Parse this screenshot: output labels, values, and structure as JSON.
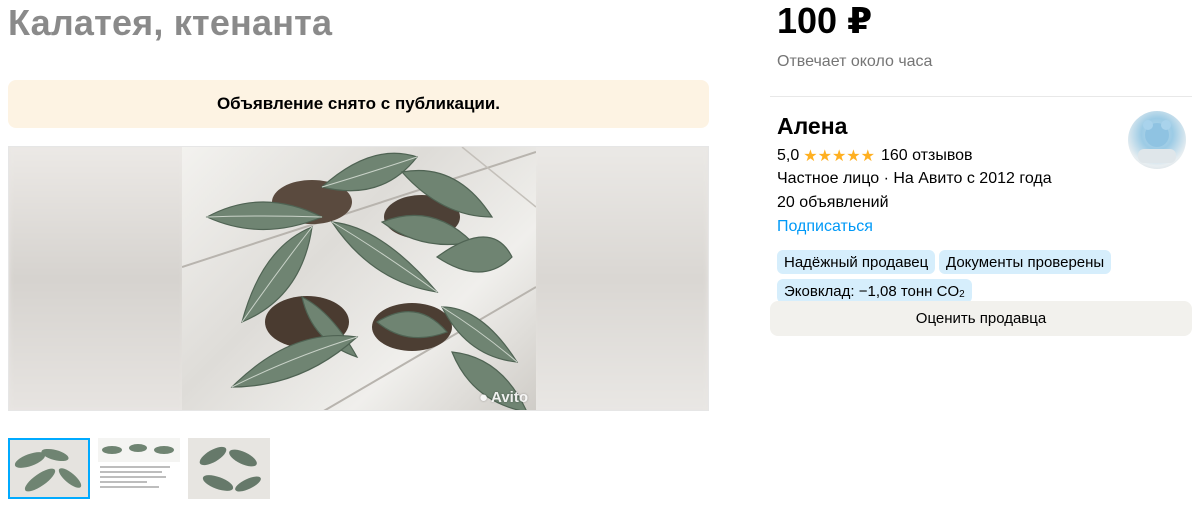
{
  "listing": {
    "title": "Калатея, ктенанта",
    "notice": "Объявление снято с публикации.",
    "watermark": "Avito"
  },
  "sidebar": {
    "price": "100 ₽",
    "reply_time": "Отвечает около часа",
    "seller": {
      "name": "Алена",
      "rating": "5,0",
      "stars": "★★★★★",
      "reviews": "160 отзывов",
      "type_since": "Частное лицо · На Авито с 2012 года",
      "ads_count": "20 объявлений",
      "subscribe": "Подписаться"
    },
    "badges": {
      "reliable": "Надёжный продавец",
      "documents": "Документы проверены",
      "eco_prefix": "Эковклад: −1,08 тонн CO",
      "eco_sub": "2"
    },
    "rate_button": "Оценить продавца"
  },
  "colors": {
    "accent": "#0099f7",
    "star": "#ffb021",
    "notice_bg": "#fdf3e3",
    "badge_bg": "#d6eefc",
    "active_thumb": "#00aaff"
  }
}
